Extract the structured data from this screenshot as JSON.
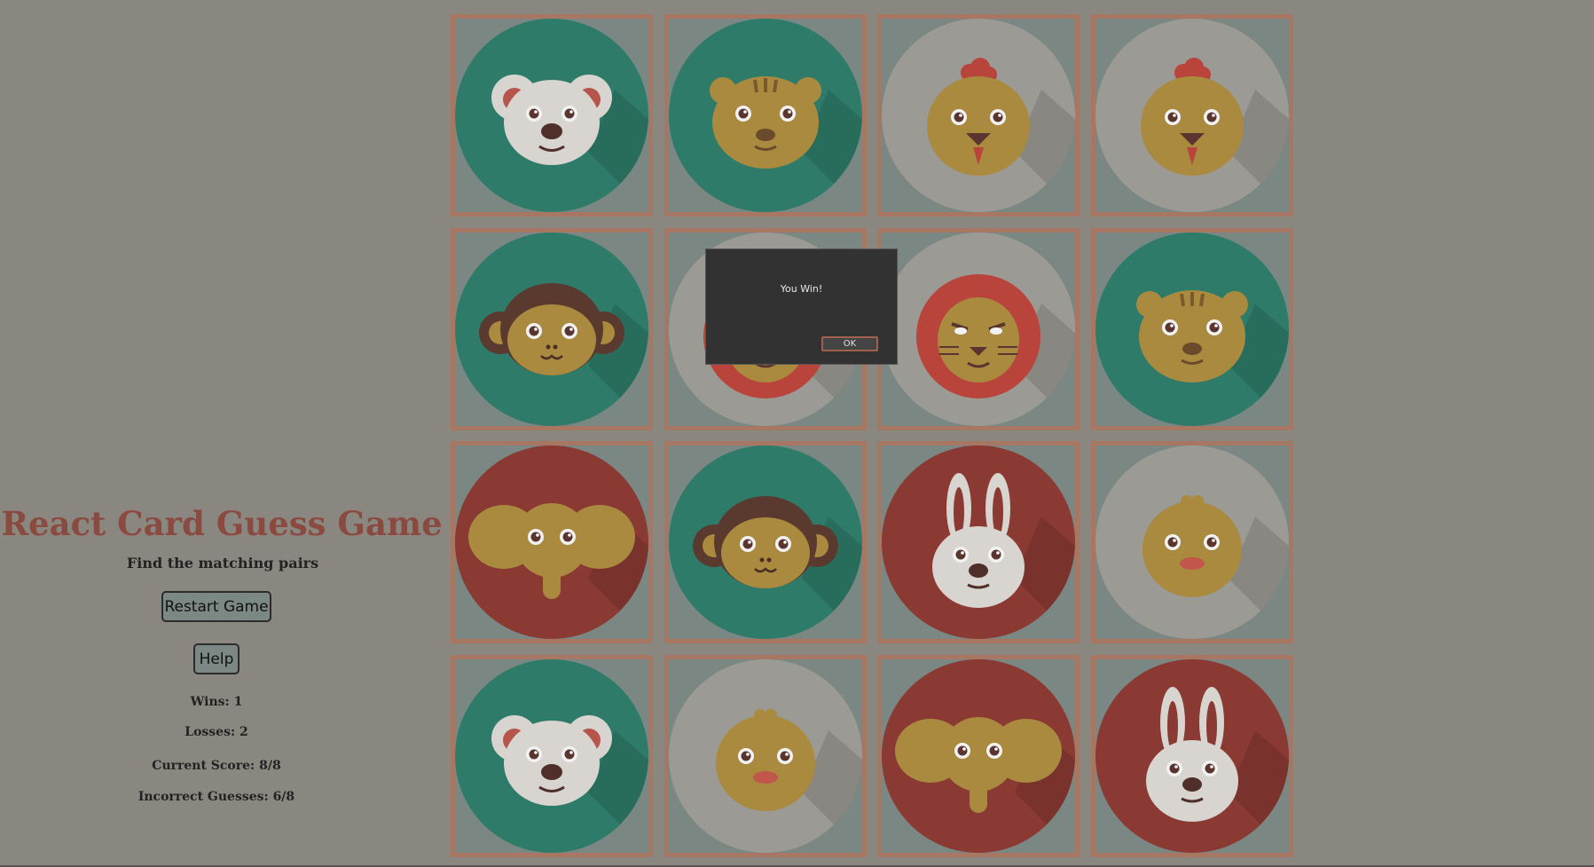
{
  "sidebar": {
    "title": "React Card Guess Game",
    "subtitle": "Find the matching pairs",
    "restart_label": "Restart Game",
    "help_label": "Help",
    "wins": "Wins: 1",
    "losses": "Losses: 2",
    "current_score": "Current Score: 8/8",
    "incorrect_guesses": "Incorrect Guesses: 6/8"
  },
  "board": {
    "rows": 4,
    "cols": 4,
    "cards": [
      {
        "animal": "mouse",
        "bg": "#2e7b69"
      },
      {
        "animal": "tiger",
        "bg": "#2e7b69"
      },
      {
        "animal": "chicken",
        "bg": "#9c9a94"
      },
      {
        "animal": "chicken",
        "bg": "#9c9a94"
      },
      {
        "animal": "monkey",
        "bg": "#2e7b69"
      },
      {
        "animal": "lion",
        "bg": "#9c9a94"
      },
      {
        "animal": "lion",
        "bg": "#9c9a94"
      },
      {
        "animal": "tiger",
        "bg": "#2e7b69"
      },
      {
        "animal": "elephant",
        "bg": "#8a3a33"
      },
      {
        "animal": "monkey",
        "bg": "#2e7b69"
      },
      {
        "animal": "rabbit",
        "bg": "#8a3a33"
      },
      {
        "animal": "chick",
        "bg": "#9c9a94"
      },
      {
        "animal": "mouse",
        "bg": "#2e7b69"
      },
      {
        "animal": "chick",
        "bg": "#9c9a94"
      },
      {
        "animal": "elephant",
        "bg": "#8a3a33"
      },
      {
        "animal": "rabbit",
        "bg": "#8a3a33"
      }
    ]
  },
  "modal": {
    "message": "You Win!",
    "ok_label": "OK"
  },
  "colors": {
    "page_bg": "#8a8780",
    "card_border": "#a77763",
    "title": "#8b4a3f"
  }
}
